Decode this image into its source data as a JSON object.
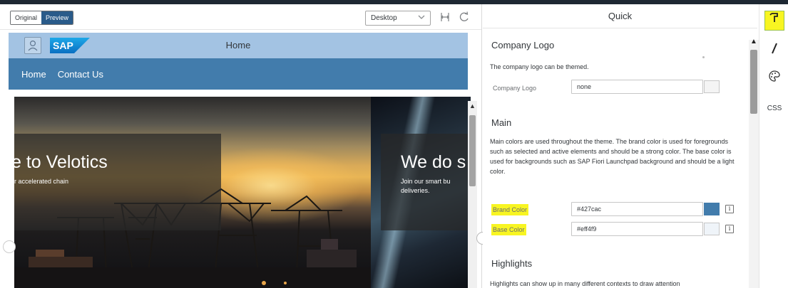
{
  "toolbar": {
    "original_label": "Original",
    "preview_label": "Preview",
    "device_value": "Desktop"
  },
  "shell": {
    "logo_text": "SAP",
    "title": "Home",
    "brand_color": "#427cac",
    "shellbar_color": "#a3c3e3"
  },
  "nav": {
    "items": [
      {
        "label": "Home"
      },
      {
        "label": "Contact Us"
      }
    ]
  },
  "carousel": {
    "slide1": {
      "title": "e to Velotics",
      "subtitle": "r accelerated chain"
    },
    "slide2": {
      "title": "We do s",
      "subtitle_line1": "Join our smart bu",
      "subtitle_line2": "deliveries."
    }
  },
  "quick": {
    "title": "Quick",
    "company_logo": {
      "heading": "Company Logo",
      "description": "The company logo can be themed.",
      "field_label": "Company Logo",
      "field_value": "none"
    },
    "main": {
      "heading": "Main",
      "description": "Main colors are used throughout the theme. The brand color is used for foregrounds such as selected and active elements and should be a strong color. The base color is used for backgrounds such as SAP Fiori Launchpad background and should be a light color.",
      "brand_label": "Brand Color",
      "brand_value": "#427cac",
      "base_label": "Base Color",
      "base_value": "#eff4f9"
    },
    "highlights": {
      "heading": "Highlights",
      "description": "Highlights can show up in many different contexts to draw attention"
    }
  },
  "side_tools": {
    "css_label": "CSS"
  },
  "icons": [
    "person-icon",
    "sap-logo",
    "chevron-down-icon",
    "fit-icon",
    "refresh-icon",
    "brush-icon",
    "pencil-icon",
    "palette-icon",
    "info-icon"
  ],
  "colors": {
    "highlight": "#f8f522",
    "brand_swatch": "#427cac",
    "base_swatch": "#eff4f9"
  }
}
